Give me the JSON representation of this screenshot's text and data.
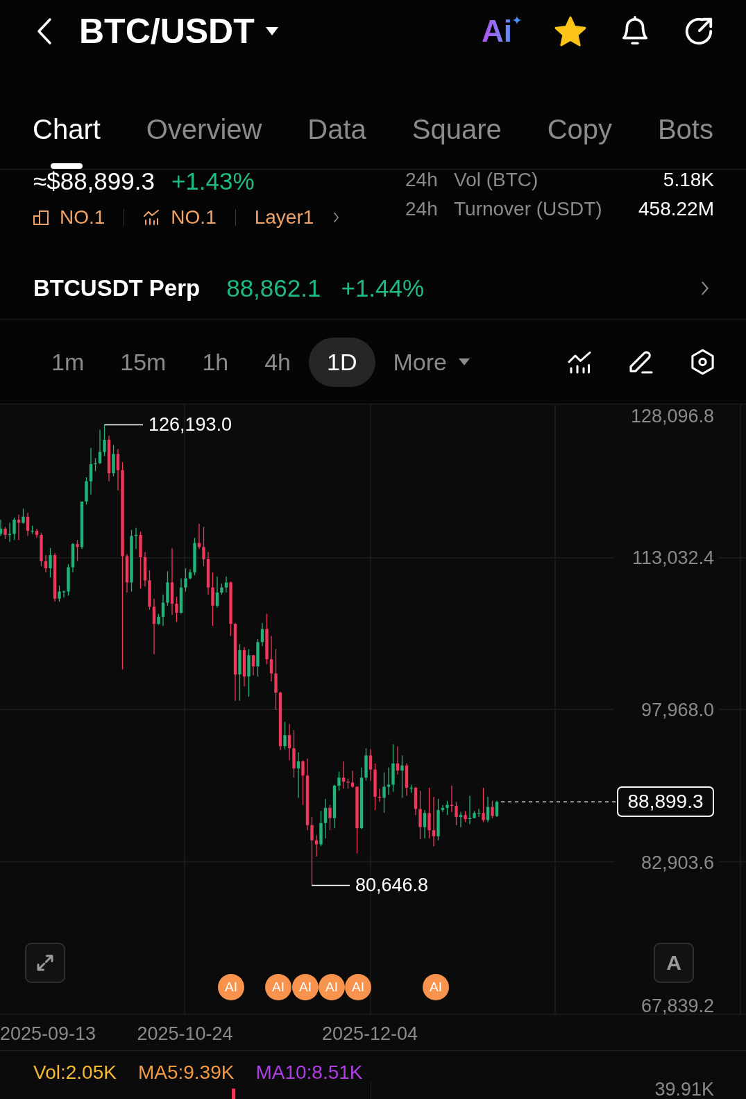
{
  "header": {
    "title": "BTC/USDT",
    "ai_label": "Ai",
    "favorite": true
  },
  "tabs": [
    {
      "label": "Chart",
      "selected": true
    },
    {
      "label": "Overview",
      "selected": false
    },
    {
      "label": "Data",
      "selected": false
    },
    {
      "label": "Square",
      "selected": false
    },
    {
      "label": "Copy",
      "selected": false
    },
    {
      "label": "Bots",
      "selected": false
    }
  ],
  "ticker": {
    "price": "≈$88,899.3",
    "change": "+1.43%",
    "rankings": [
      {
        "kind": "rank",
        "label": "NO.1"
      },
      {
        "kind": "trend",
        "label": "NO.1"
      },
      {
        "kind": "sector",
        "label": "Layer1"
      }
    ],
    "stats": [
      {
        "period": "24h",
        "label": "Vol (BTC)",
        "value": "5.18K"
      },
      {
        "period": "24h",
        "label": "Turnover (USDT)",
        "value": "458.22M"
      }
    ]
  },
  "perpetual": {
    "name": "BTCUSDT Perp",
    "price": "88,862.1",
    "change": "+1.44%"
  },
  "intervals": [
    {
      "kind": "interval",
      "label": "1m",
      "selected": false
    },
    {
      "kind": "interval",
      "label": "15m",
      "selected": false
    },
    {
      "kind": "interval",
      "label": "1h",
      "selected": false
    },
    {
      "kind": "interval",
      "label": "4h",
      "selected": false
    },
    {
      "kind": "interval",
      "label": "1D",
      "selected": true
    },
    {
      "kind": "menu",
      "label": "More",
      "selected": false
    }
  ],
  "chart": {
    "price_axis": [
      "128,096.8",
      "113,032.4",
      "97,968.0",
      "82,903.6",
      "67,839.2"
    ],
    "high_label": "126,193.0",
    "low_label": "80,646.8",
    "last_price": "88,899.3",
    "scale_button": "A",
    "ai_markers": [
      "AI",
      "AI",
      "AI",
      "AI",
      "AI",
      "AI"
    ],
    "date_axis": [
      "2025-09-13",
      "2025-10-24",
      "2025-12-04"
    ]
  },
  "volume": {
    "indicators": [
      {
        "label": "Vol:2.05K",
        "color": "#f5b82e"
      },
      {
        "label": "MA5:9.39K",
        "color": "#f39a45"
      },
      {
        "label": "MA10:8.51K",
        "color": "#b03ee6"
      }
    ],
    "axis_label": "39.91K"
  }
}
